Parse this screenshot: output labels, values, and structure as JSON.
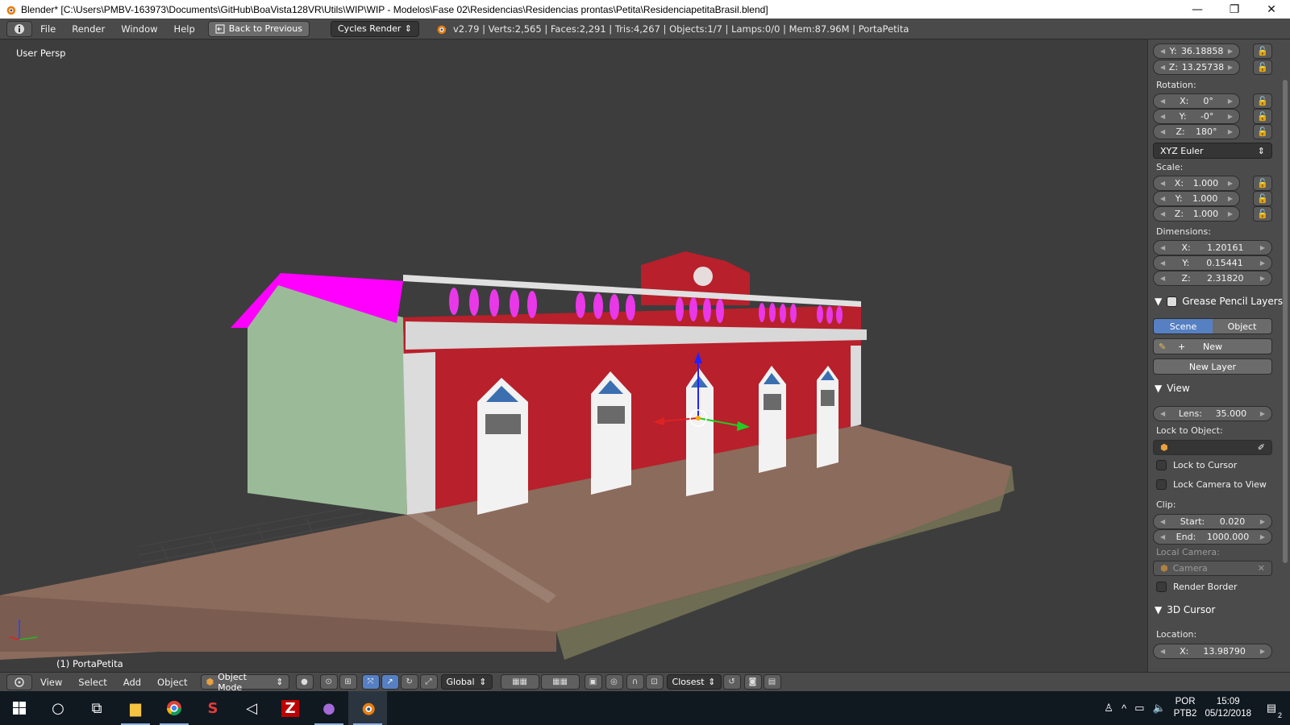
{
  "window": {
    "title": "Blender* [C:\\Users\\PMBV-163973\\Documents\\GitHub\\BoaVista128VR\\Utils\\WIP\\WIP - Modelos\\Fase 02\\Residencias\\Residencias prontas\\Petita\\ResidenciapetitaBrasil.blend]",
    "minimize": "—",
    "maximize": "❐",
    "close": "✕"
  },
  "info_header": {
    "menus": [
      "File",
      "Render",
      "Window",
      "Help"
    ],
    "back_label": "Back to Previous",
    "render_engine": "Cycles Render",
    "stats": "v2.79 | Verts:2,565 | Faces:2,291 | Tris:4,267 | Objects:1/7 | Lamps:0/0 | Mem:87.96M | PortaPetita"
  },
  "viewport": {
    "view_name": "User Persp",
    "active_object": "(1) PortaPetita"
  },
  "npanel": {
    "location": {
      "y_label": "Y:",
      "y": "36.18858",
      "z_label": "Z:",
      "z": "13.25738"
    },
    "rotation_label": "Rotation:",
    "rotation": {
      "x_label": "X:",
      "x": "0°",
      "y_label": "Y:",
      "y": "-0°",
      "z_label": "Z:",
      "z": "180°"
    },
    "rotation_mode": "XYZ Euler",
    "scale_label": "Scale:",
    "scale": {
      "x_label": "X:",
      "x": "1.000",
      "y_label": "Y:",
      "y": "1.000",
      "z_label": "Z:",
      "z": "1.000"
    },
    "dimensions_label": "Dimensions:",
    "dimensions": {
      "x_label": "X:",
      "x": "1.20161",
      "y_label": "Y:",
      "y": "0.15441",
      "z_label": "Z:",
      "z": "2.31820"
    },
    "grease_pencil": {
      "title": "Grease Pencil Layers",
      "scene_tab": "Scene",
      "object_tab": "Object",
      "new_label": "New",
      "new_layer_label": "New Layer"
    },
    "view": {
      "title": "View",
      "lens_label": "Lens:",
      "lens": "35.000",
      "lock_to_object_label": "Lock to Object:",
      "lock_to_cursor": "Lock to Cursor",
      "lock_camera_to_view": "Lock Camera to View",
      "clip_label": "Clip:",
      "clip_start_label": "Start:",
      "clip_start": "0.020",
      "clip_end_label": "End:",
      "clip_end": "1000.000",
      "local_camera_label": "Local Camera:",
      "local_camera": "Camera",
      "render_border": "Render Border"
    },
    "cursor": {
      "title": "3D Cursor",
      "location_label": "Location:",
      "x_label": "X:",
      "x": "13.98790"
    }
  },
  "view_header": {
    "menus": [
      "View",
      "Select",
      "Add",
      "Object"
    ],
    "mode": "Object Mode",
    "orientation": "Global",
    "snap_target": "Closest"
  },
  "taskbar": {
    "language_line1": "POR",
    "language_line2": "PTB2",
    "time": "15:09",
    "date": "05/12/2018",
    "notifications": "2"
  },
  "colors": {
    "facade_red": "#b8202b",
    "roof_magenta": "#ff00ff",
    "side_wall": "#9bbb98",
    "ground": "#8a6a5a",
    "active_blue": "#5680c2"
  }
}
